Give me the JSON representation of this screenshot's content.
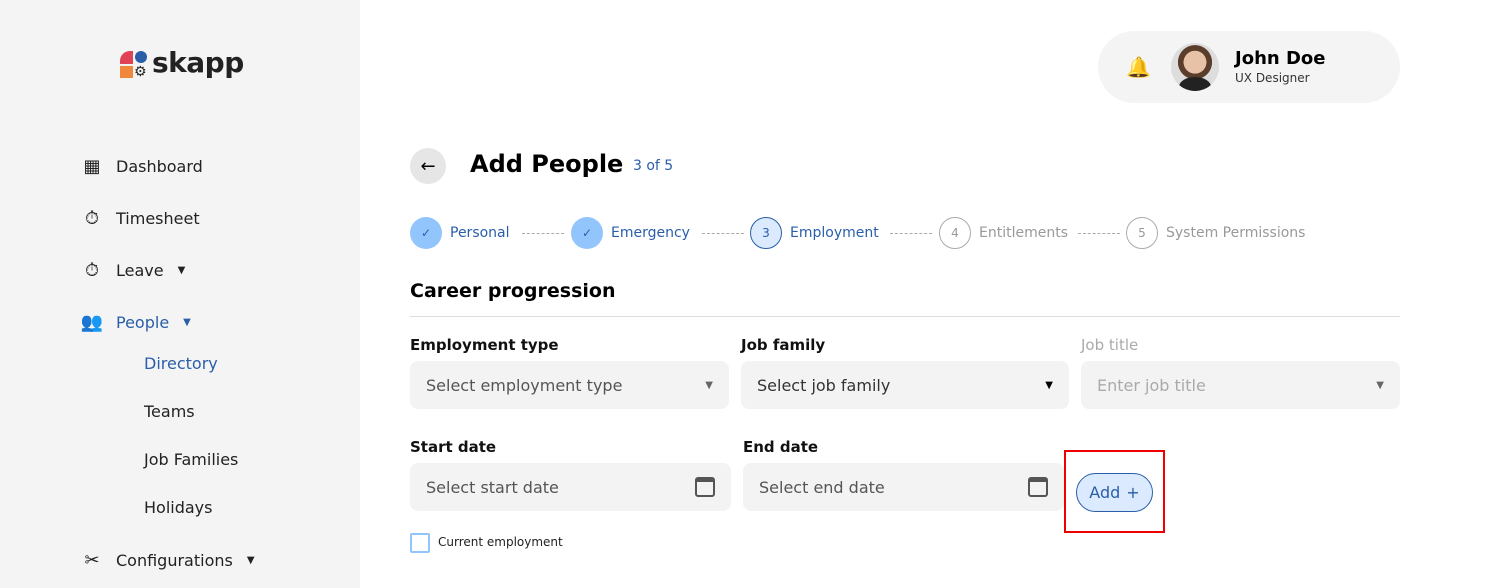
{
  "brand": {
    "name": "skapp"
  },
  "sidebar": {
    "items": [
      {
        "label": "Dashboard",
        "icon": "dashboard-icon"
      },
      {
        "label": "Timesheet",
        "icon": "stopwatch-icon"
      },
      {
        "label": "Leave",
        "icon": "leave-icon"
      },
      {
        "label": "People",
        "icon": "people-icon",
        "active": true
      },
      {
        "label": "Configurations",
        "icon": "tools-icon"
      }
    ],
    "people_sub": [
      "Directory",
      "Teams",
      "Job Families",
      "Holidays"
    ]
  },
  "profile": {
    "name": "John Doe",
    "role": "UX Designer"
  },
  "header": {
    "title": "Add People",
    "step_count": "3 of 5"
  },
  "steps": [
    {
      "num": "✓",
      "label": "Personal"
    },
    {
      "num": "✓",
      "label": "Emergency"
    },
    {
      "num": "3",
      "label": "Employment"
    },
    {
      "num": "4",
      "label": "Entitlements"
    },
    {
      "num": "5",
      "label": "System Permissions"
    }
  ],
  "form": {
    "section": "Career progression",
    "employment_type": {
      "label": "Employment type",
      "placeholder": "Select employment type"
    },
    "job_family": {
      "label": "Job family",
      "placeholder": "Select job family"
    },
    "job_title": {
      "label": "Job title",
      "placeholder": "Enter job title"
    },
    "start_date": {
      "label": "Start date",
      "placeholder": "Select start date"
    },
    "end_date": {
      "label": "End date",
      "placeholder": "Select end date"
    },
    "add_label": "Add",
    "add_icon": "+",
    "current_employment": "Current employment"
  },
  "colors": {
    "accent": "#2a5ea8",
    "sidebar_bg": "#f4f4f4",
    "highlight": "#e00000"
  }
}
